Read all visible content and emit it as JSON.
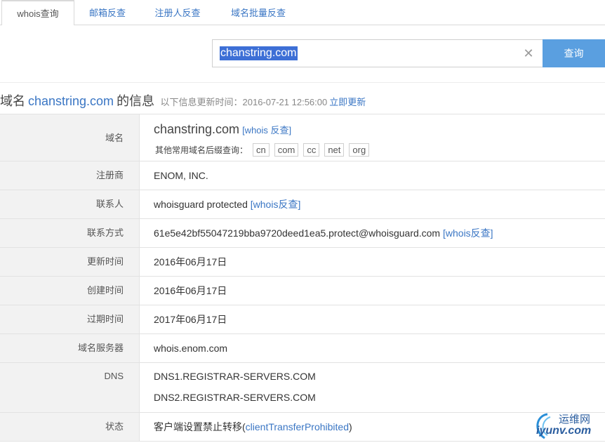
{
  "tabs": [
    {
      "label": "whois查询",
      "active": true
    },
    {
      "label": "邮箱反查",
      "active": false
    },
    {
      "label": "注册人反查",
      "active": false
    },
    {
      "label": "域名批量反查",
      "active": false
    }
  ],
  "search": {
    "value": "chanstring.com",
    "button_label": "查询"
  },
  "heading": {
    "prefix": "域名",
    "domain": "chanstring.com",
    "suffix": "的信息",
    "updated_text": "以下信息更新时间：2016-07-21 12:56:00",
    "update_link": "立即更新"
  },
  "rows": {
    "domain": {
      "label": "域名",
      "value": "chanstring.com",
      "whois_link": "[whois 反查]",
      "suffix_prompt": "其他常用域名后缀查询：",
      "suffixes": [
        "cn",
        "com",
        "cc",
        "net",
        "org"
      ]
    },
    "registrar": {
      "label": "注册商",
      "value": "ENOM, INC."
    },
    "contact": {
      "label": "联系人",
      "value": "whoisguard protected",
      "link": "[whois反查]"
    },
    "contact_method": {
      "label": "联系方式",
      "value": "61e5e42bf55047219bba9720deed1ea5.protect@whoisguard.com",
      "link": "[whois反查]"
    },
    "updated": {
      "label": "更新时间",
      "value": "2016年06月17日"
    },
    "created": {
      "label": "创建时间",
      "value": "2016年06月17日"
    },
    "expires": {
      "label": "过期时间",
      "value": "2017年06月17日"
    },
    "name_server": {
      "label": "域名服务器",
      "value": "whois.enom.com"
    },
    "dns": {
      "label": "DNS",
      "values": [
        "DNS1.REGISTRAR-SERVERS.COM",
        "DNS2.REGISTRAR-SERVERS.COM"
      ]
    },
    "status": {
      "label": "状态",
      "value_prefix": "客户端设置禁止转移(",
      "value_link": "clientTransferProhibited",
      "value_suffix": ")"
    }
  },
  "watermark": {
    "name": "运维网",
    "url": "iyunv.com"
  },
  "colors": {
    "accent": "#3a76c4",
    "button": "#5a9fe0",
    "label_bg": "#f2f2f2"
  }
}
